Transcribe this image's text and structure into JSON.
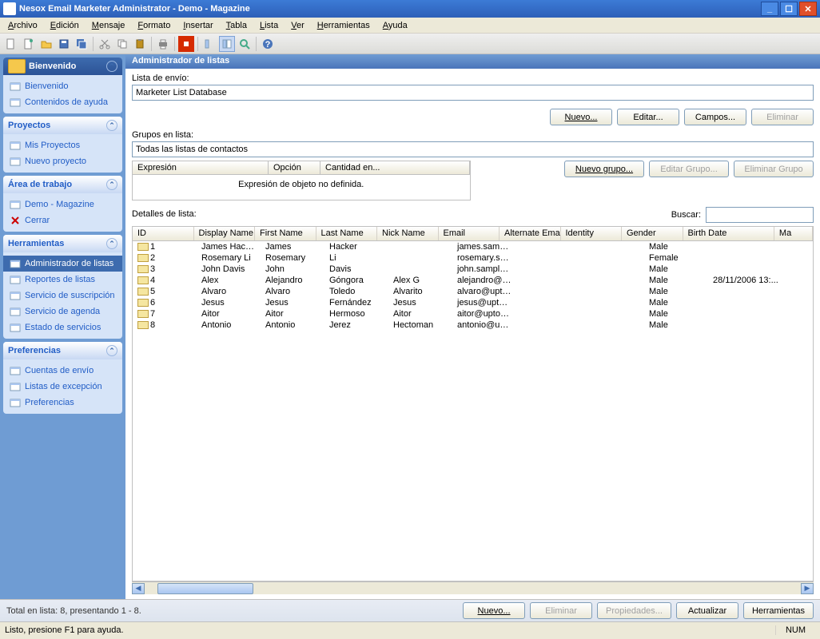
{
  "title": "Nesox Email Marketer Administrator - Demo - Magazine",
  "menus": [
    "Archivo",
    "Edición",
    "Mensaje",
    "Formato",
    "Insertar",
    "Tabla",
    "Lista",
    "Ver",
    "Herramientas",
    "Ayuda"
  ],
  "sidebar": {
    "welcome": {
      "title": "Bienvenido",
      "items": [
        "Bienvenido",
        "Contenidos de ayuda"
      ]
    },
    "projects": {
      "title": "Proyectos",
      "items": [
        "Mis Proyectos",
        "Nuevo proyecto"
      ]
    },
    "workspace": {
      "title": "Área de trabajo",
      "items": [
        "Demo - Magazine",
        "Cerrar"
      ]
    },
    "tools": {
      "title": "Herramientas",
      "items": [
        "Administrador de listas",
        "Reportes de listas",
        "Servicio de suscripción",
        "Servicio de agenda",
        "Estado de servicios"
      ],
      "selected": 0
    },
    "prefs": {
      "title": "Preferencias",
      "items": [
        "Cuentas de envío",
        "Listas de excepción",
        "Preferencias"
      ]
    }
  },
  "main": {
    "header": "Administrador de listas",
    "list_label": "Lista de envío:",
    "list_value": "Marketer List Database",
    "buttons1": {
      "new": "Nuevo...",
      "edit": "Editar...",
      "fields": "Campos...",
      "delete": "Eliminar"
    },
    "groups_label": "Grupos en lista:",
    "groups_value": "Todas las listas de contactos",
    "expr_cols": [
      "Expresión",
      "Opción",
      "Cantidad en..."
    ],
    "expr_empty": "Expresión de objeto no definida.",
    "buttons2": {
      "newgroup": "Nuevo grupo...",
      "editgroup": "Editar Grupo...",
      "delgroup": "Eliminar Grupo"
    },
    "detail_label": "Detalles de lista:",
    "search_label": "Buscar:",
    "columns": [
      "ID",
      "Display Name",
      "First Name",
      "Last Name",
      "Nick Name",
      "Email",
      "Alternate Email",
      "Identity",
      "Gender",
      "Birth Date",
      "Ma"
    ],
    "rows": [
      {
        "id": "1",
        "dn": "James Hacker",
        "fn": "James",
        "ln": "Hacker",
        "nn": "",
        "em": "james.sample@...",
        "ae": "",
        "idn": "",
        "g": "Male",
        "bd": ""
      },
      {
        "id": "2",
        "dn": "Rosemary Li",
        "fn": "Rosemary",
        "ln": "Li",
        "nn": "",
        "em": "rosemary.sampl...",
        "ae": "",
        "idn": "",
        "g": "Female",
        "bd": ""
      },
      {
        "id": "3",
        "dn": "John Davis",
        "fn": "John",
        "ln": "Davis",
        "nn": "",
        "em": "john.sample@g...",
        "ae": "",
        "idn": "",
        "g": "Male",
        "bd": ""
      },
      {
        "id": "4",
        "dn": "Alex",
        "fn": "Alejandro",
        "ln": "Góngora",
        "nn": "Alex G",
        "em": "alejandro@upt...",
        "ae": "",
        "idn": "",
        "g": "Male",
        "bd": "28/11/2006 13:..."
      },
      {
        "id": "5",
        "dn": "Alvaro",
        "fn": "Alvaro",
        "ln": "Toledo",
        "nn": "Alvarito",
        "em": "alvaro@uptodo...",
        "ae": "",
        "idn": "",
        "g": "Male",
        "bd": ""
      },
      {
        "id": "6",
        "dn": "Jesus",
        "fn": "Jesus",
        "ln": "Fernández",
        "nn": "Jesus",
        "em": "jesus@uptodo...",
        "ae": "",
        "idn": "",
        "g": "Male",
        "bd": ""
      },
      {
        "id": "7",
        "dn": "Aitor",
        "fn": "Aitor",
        "ln": "Hermoso",
        "nn": "Aitor",
        "em": "aitor@uptodow...",
        "ae": "",
        "idn": "",
        "g": "Male",
        "bd": ""
      },
      {
        "id": "8",
        "dn": "Antonio",
        "fn": "Antonio",
        "ln": "Jerez",
        "nn": "Hectoman",
        "em": "antonio@uptod...",
        "ae": "",
        "idn": "",
        "g": "Male",
        "bd": ""
      }
    ],
    "footer_summary": "Total en lista: 8, presentando 1 - 8.",
    "footer_buttons": {
      "new": "Nuevo...",
      "delete": "Eliminar",
      "props": "Propiedades...",
      "refresh": "Actualizar",
      "tools": "Herramientas"
    }
  },
  "status": {
    "left": "Listo, presione F1 para ayuda.",
    "right": "NUM"
  }
}
